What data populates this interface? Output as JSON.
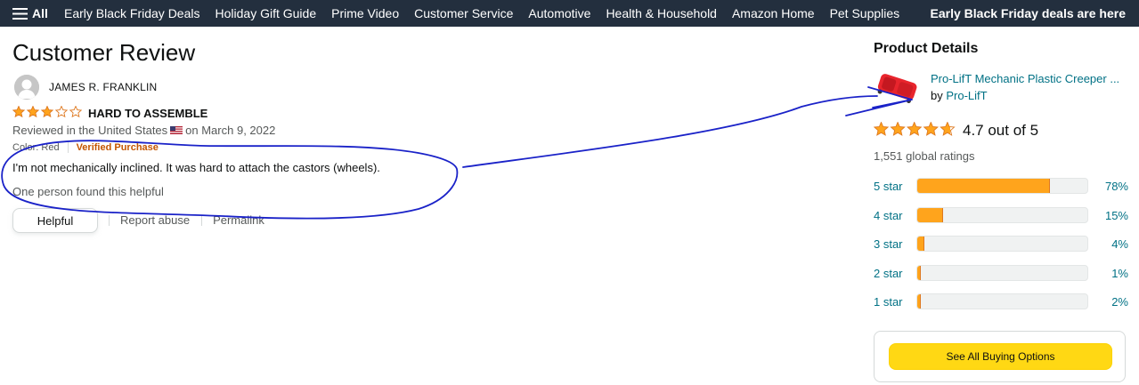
{
  "nav": {
    "all_label": "All",
    "links": [
      "Early Black Friday Deals",
      "Holiday Gift Guide",
      "Prime Video",
      "Customer Service",
      "Automotive",
      "Health & Household",
      "Amazon Home",
      "Pet Supplies"
    ],
    "promo": "Early Black Friday deals are here"
  },
  "review": {
    "section_title": "Customer Review",
    "reviewer_name": "JAMES R. FRANKLIN",
    "rating_stars": 3,
    "headline": "HARD TO ASSEMBLE",
    "reviewed_in": "Reviewed in the United States",
    "date": "on March 9, 2022",
    "variant": "Color: Red",
    "verified": "Verified Purchase",
    "body": "I'm not mechanically inclined. It was hard to attach the castors (wheels).",
    "helpful_count": "One person found this helpful",
    "helpful_button": "Helpful",
    "report_abuse": "Report abuse",
    "permalink": "Permalink"
  },
  "product": {
    "section_title": "Product Details",
    "name": "Pro-LifT Mechanic Plastic Creeper ...",
    "by_label": "by",
    "brand": "Pro-LifT",
    "rating_stars": 4.7,
    "rating_text": "4.7 out of 5",
    "global_ratings": "1,551 global ratings",
    "histogram": [
      {
        "label": "5 star",
        "percent": 78,
        "percent_text": "78%"
      },
      {
        "label": "4 star",
        "percent": 15,
        "percent_text": "15%"
      },
      {
        "label": "3 star",
        "percent": 4,
        "percent_text": "4%"
      },
      {
        "label": "2 star",
        "percent": 1,
        "percent_text": "1%"
      },
      {
        "label": "1 star",
        "percent": 2,
        "percent_text": "2%"
      }
    ],
    "buy_button": "See All Buying Options"
  },
  "colors": {
    "nav_bg": "#232f3e",
    "star": "#ffa41c",
    "link": "#007185",
    "verified": "#c45500",
    "buy_button": "#ffd814",
    "annotation_ink": "#1a22c8"
  },
  "icons": {
    "menu": "hamburger-icon",
    "avatar": "user-avatar-icon",
    "flag": "us-flag-icon",
    "star": "star-icon",
    "product": "creeper-product-thumbnail"
  }
}
